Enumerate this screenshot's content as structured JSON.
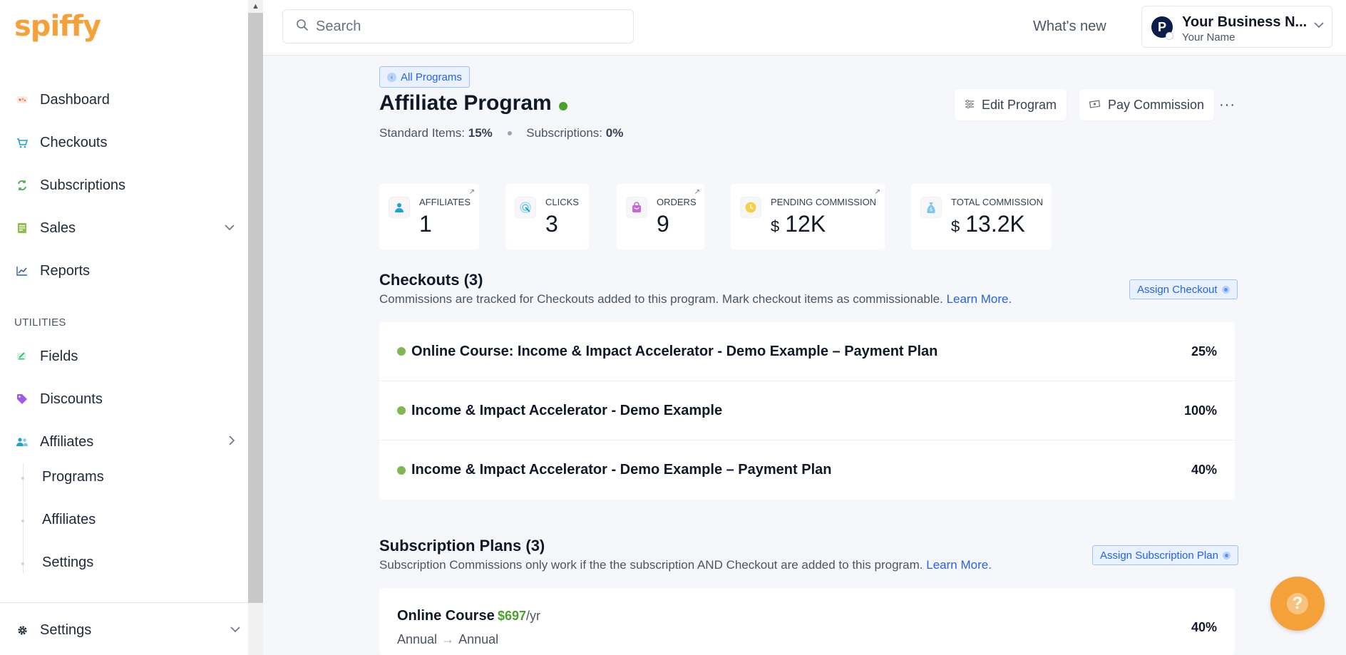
{
  "brand": {
    "logo": "spiffy",
    "accent": "#f4a13a"
  },
  "sidebar": {
    "items": [
      {
        "label": "Dashboard",
        "icon": "dashboard-icon"
      },
      {
        "label": "Checkouts",
        "icon": "cart-icon"
      },
      {
        "label": "Subscriptions",
        "icon": "refresh-icon"
      },
      {
        "label": "Sales",
        "icon": "receipt-icon"
      },
      {
        "label": "Reports",
        "icon": "chart-line-icon"
      }
    ],
    "utilities_label": "UTILITIES",
    "utilities": [
      {
        "label": "Fields",
        "icon": "form-icon"
      },
      {
        "label": "Discounts",
        "icon": "tag-icon"
      },
      {
        "label": "Affiliates",
        "icon": "users-icon"
      }
    ],
    "affiliates_sub": [
      "Programs",
      "Affiliates",
      "Settings"
    ],
    "settings_label": "Settings"
  },
  "topbar": {
    "search_placeholder": "Search",
    "whats_new": "What's new",
    "account": {
      "business": "Your Business N...",
      "name": "Your Name",
      "avatar_letter": "P"
    }
  },
  "program": {
    "back_label": "All Programs",
    "title": "Affiliate Program",
    "standard_label": "Standard Items:",
    "standard_value": "15%",
    "subscriptions_label": "Subscriptions:",
    "subscriptions_value": "0%",
    "edit_label": "Edit Program",
    "pay_label": "Pay Commission",
    "more_label": "···"
  },
  "stats": [
    {
      "label": "AFFILIATES",
      "value": "1",
      "currency": ""
    },
    {
      "label": "CLICKS",
      "value": "3",
      "currency": ""
    },
    {
      "label": "ORDERS",
      "value": "9",
      "currency": ""
    },
    {
      "label": "PENDING COMMISSION",
      "value": "12K",
      "currency": "$"
    },
    {
      "label": "TOTAL COMMISSION",
      "value": "13.2K",
      "currency": "$"
    }
  ],
  "checkouts": {
    "title": "Checkouts (3)",
    "desc": "Commissions are tracked for Checkouts added to this program. Mark checkout items as commissionable.",
    "learn_more": "Learn More.",
    "assign_label": "Assign Checkout",
    "rows": [
      {
        "name": "Online Course: Income & Impact Accelerator - Demo Example – Payment Plan",
        "pct": "25%"
      },
      {
        "name": "Income & Impact Accelerator - Demo Example",
        "pct": "100%"
      },
      {
        "name": "Income & Impact Accelerator - Demo Example – Payment Plan",
        "pct": "40%"
      }
    ]
  },
  "subscription_plans": {
    "title": "Subscription Plans (3)",
    "desc": "Subscription Commissions only work if the the subscription AND Checkout are added to this program.",
    "learn_more": "Learn More.",
    "assign_label": "Assign Subscription Plan",
    "rows": [
      {
        "name": "Online Course",
        "price": "$697",
        "period": "/yr",
        "from": "Annual",
        "to": "Annual",
        "pct": "40%"
      }
    ]
  },
  "help_label": "?"
}
